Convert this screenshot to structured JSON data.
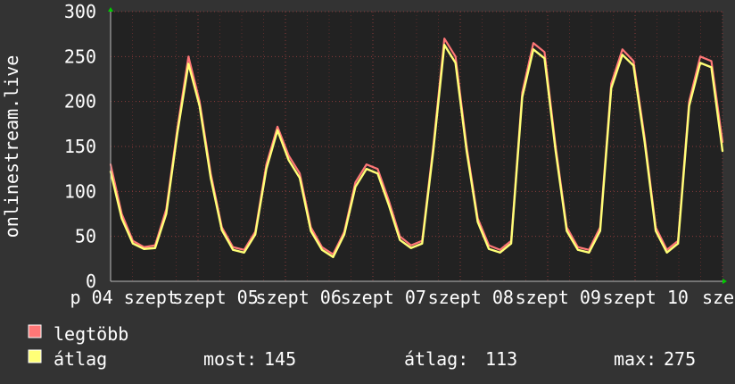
{
  "chart_data": {
    "type": "line",
    "title": "",
    "ylabel": "onlinestream.live",
    "xlabel": "",
    "ylim": [
      0,
      300
    ],
    "yticks": [
      0,
      50,
      100,
      150,
      200,
      250,
      300
    ],
    "grid": true,
    "x_tick_labels": [
      "p 04 szept",
      "szept 05",
      "szept 06",
      "szept 07",
      "szept 08",
      "szept 09",
      "szept 10",
      "sze"
    ],
    "x_positions": [
      0.0,
      0.2,
      0.4,
      0.6,
      0.8,
      1.0,
      1.2,
      1.4,
      1.6,
      1.8,
      2.0,
      2.2,
      2.4,
      2.6,
      2.8,
      3.0,
      3.2,
      3.4,
      3.6,
      3.8,
      4.0,
      4.2,
      4.4,
      4.6,
      4.8,
      5.0,
      5.2,
      5.4,
      5.6,
      5.8,
      6.0,
      6.2,
      6.4,
      6.6,
      6.8,
      7.0
    ],
    "series": [
      {
        "name": "legtöbb",
        "color": "#ff7777",
        "values": [
          130,
          75,
          45,
          38,
          40,
          80,
          170,
          250,
          200,
          120,
          60,
          38,
          35,
          55,
          130,
          172,
          140,
          120,
          60,
          38,
          30,
          55,
          110,
          130,
          125,
          90,
          50,
          40,
          45,
          150,
          270,
          250,
          150,
          70,
          40,
          35,
          45,
          210,
          265,
          255,
          150,
          60,
          38,
          35,
          60,
          220,
          258,
          245,
          160,
          60,
          35,
          45,
          200,
          250,
          245,
          155
        ]
      },
      {
        "name": "átlag",
        "color": "#ffff77",
        "values": [
          122,
          70,
          42,
          36,
          37,
          75,
          165,
          242,
          195,
          115,
          57,
          35,
          32,
          52,
          125,
          168,
          135,
          115,
          56,
          35,
          27,
          52,
          105,
          125,
          120,
          85,
          46,
          37,
          42,
          145,
          263,
          243,
          145,
          66,
          36,
          32,
          42,
          205,
          258,
          248,
          145,
          56,
          35,
          32,
          56,
          215,
          252,
          240,
          155,
          56,
          32,
          42,
          195,
          243,
          238,
          145
        ]
      }
    ]
  },
  "legend": [
    {
      "label": "legtöbb",
      "color": "#ff7777"
    },
    {
      "label": "átlag",
      "color": "#ffff77"
    }
  ],
  "stats": {
    "now_label": "most:",
    "now_value": "145",
    "avg_label": "átlag:",
    "avg_value": "113",
    "max_label": "max:",
    "max_value": "275"
  }
}
